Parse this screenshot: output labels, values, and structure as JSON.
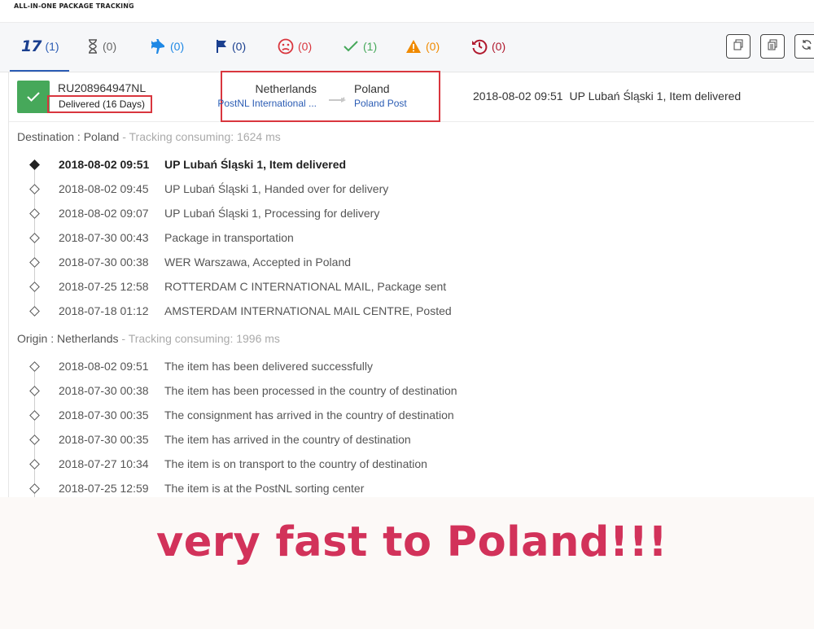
{
  "brand": "ALL-IN-ONE PACKAGE TRACKING",
  "tabs": [
    {
      "icon": "17track-logo-icon",
      "count": "(1)",
      "color": "#2b5cb4"
    },
    {
      "icon": "hourglass-icon",
      "count": "(0)",
      "color": "#666666"
    },
    {
      "icon": "airplane-icon",
      "count": "(0)",
      "color": "#1e88e5"
    },
    {
      "icon": "flag-icon",
      "count": "(0)",
      "color": "#1a3f8f"
    },
    {
      "icon": "sad-face-icon",
      "count": "(0)",
      "color": "#d9363e"
    },
    {
      "icon": "checkmark-icon",
      "count": "(1)",
      "color": "#46a85a"
    },
    {
      "icon": "warning-icon",
      "count": "(0)",
      "color": "#f08a00"
    },
    {
      "icon": "history-clock-icon",
      "count": "(0)",
      "color": "#b0192e"
    }
  ],
  "toolbar": [
    "copy-icon",
    "copy-list-icon",
    "refresh-icon"
  ],
  "package": {
    "tracking_number": "RU208964947NL",
    "status": "Delivered (16 Days)",
    "origin_country": "Netherlands",
    "origin_carrier": "PostNL International ...",
    "dest_country": "Poland",
    "dest_carrier": "Poland Post",
    "latest_time": "2018-08-02 09:51",
    "latest_event": "UP Lubań Śląski 1, Item delivered"
  },
  "destination": {
    "label": "Destination : Poland",
    "consuming": " - Tracking consuming: 1624 ms",
    "events": [
      {
        "time": "2018-08-02 09:51",
        "desc": "UP Lubań Śląski 1, Item delivered"
      },
      {
        "time": "2018-08-02 09:45",
        "desc": "UP Lubań Śląski 1, Handed over for delivery"
      },
      {
        "time": "2018-08-02 09:07",
        "desc": "UP Lubań Śląski 1, Processing for delivery"
      },
      {
        "time": "2018-07-30 00:43",
        "desc": "Package in transportation"
      },
      {
        "time": "2018-07-30 00:38",
        "desc": "WER Warszawa, Accepted in Poland"
      },
      {
        "time": "2018-07-25 12:58",
        "desc": "ROTTERDAM C INTERNATIONAL MAIL, Package sent"
      },
      {
        "time": "2018-07-18 01:12",
        "desc": "AMSTERDAM INTERNATIONAL MAIL CENTRE, Posted"
      }
    ]
  },
  "origin": {
    "label": "Origin : Netherlands",
    "consuming": " - Tracking consuming: 1996 ms",
    "events": [
      {
        "time": "2018-08-02 09:51",
        "desc": "The item has been delivered successfully"
      },
      {
        "time": "2018-07-30 00:38",
        "desc": "The item has been processed in the country of destination"
      },
      {
        "time": "2018-07-30 00:35",
        "desc": "The consignment has arrived in the country of destination"
      },
      {
        "time": "2018-07-30 00:35",
        "desc": "The item has arrived in the country of destination"
      },
      {
        "time": "2018-07-27 10:34",
        "desc": "The item is on transport to the country of destination"
      },
      {
        "time": "2018-07-25 12:59",
        "desc": "The item is at the PostNL sorting center"
      }
    ]
  },
  "promo_text": "very fast to Poland!!!"
}
